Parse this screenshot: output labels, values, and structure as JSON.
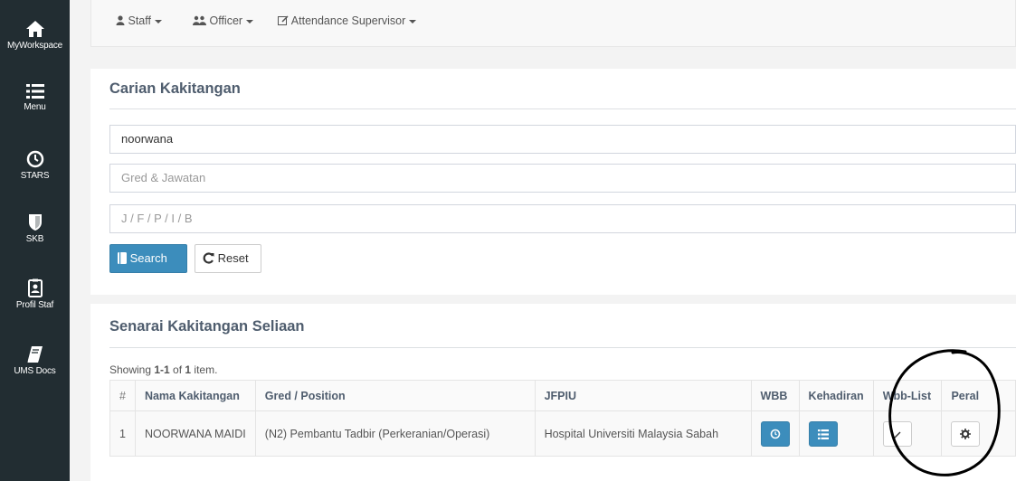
{
  "sidebar": {
    "items": [
      {
        "label": "MyWorkspace",
        "icon": "home-icon"
      },
      {
        "label": "Menu",
        "icon": "list-icon"
      },
      {
        "label": "STARS",
        "icon": "clock-icon"
      },
      {
        "label": "SKB",
        "icon": "shield-icon"
      },
      {
        "label": "Profil Staf",
        "icon": "id-badge-icon"
      },
      {
        "label": "UMS Docs",
        "icon": "book-icon"
      }
    ]
  },
  "topnav": {
    "items": [
      {
        "label": "Staff",
        "icon": "user-icon"
      },
      {
        "label": "Officer",
        "icon": "users-icon"
      },
      {
        "label": "Attendance Supervisor",
        "icon": "edit-icon"
      }
    ]
  },
  "search_panel": {
    "title": "Carian Kakitangan",
    "name_value": "noorwana",
    "grade_placeholder": "Gred & Jawatan",
    "jfpiu_placeholder": "J / F / P / I / B",
    "search_label": "Search",
    "reset_label": "Reset"
  },
  "list_panel": {
    "title": "Senarai Kakitangan Seliaan",
    "summary_prefix": "Showing ",
    "summary_range": "1-1",
    "summary_mid": " of ",
    "summary_total": "1",
    "summary_suffix": " item.",
    "columns": [
      "#",
      "Nama Kakitangan",
      "Gred / Position",
      "JFPIU",
      "WBB",
      "Kehadiran",
      "Wbb-List",
      "Peral"
    ],
    "rows": [
      {
        "num": "1",
        "name": "NOORWANA MAIDI",
        "position": "(N2) Pembantu Tadbir (Perkeranian/Operasi)",
        "jfpiu": "Hospital Universiti Malaysia Sabah"
      }
    ]
  },
  "colors": {
    "sidebar_bg": "#222d32",
    "primary": "#3c8dbc",
    "title": "#4f5d6e"
  }
}
